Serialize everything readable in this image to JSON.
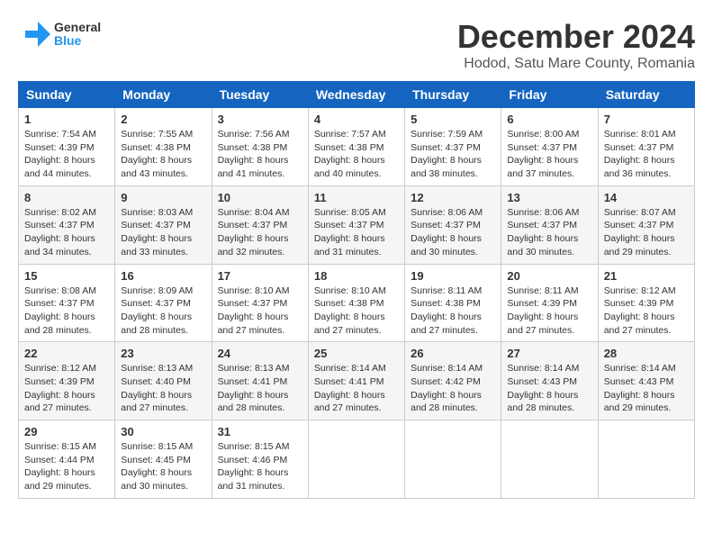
{
  "logo": {
    "line1": "General",
    "line2": "Blue"
  },
  "title": "December 2024",
  "location": "Hodod, Satu Mare County, Romania",
  "headers": [
    "Sunday",
    "Monday",
    "Tuesday",
    "Wednesday",
    "Thursday",
    "Friday",
    "Saturday"
  ],
  "weeks": [
    [
      {
        "day": "1",
        "info": "Sunrise: 7:54 AM\nSunset: 4:39 PM\nDaylight: 8 hours\nand 44 minutes."
      },
      {
        "day": "2",
        "info": "Sunrise: 7:55 AM\nSunset: 4:38 PM\nDaylight: 8 hours\nand 43 minutes."
      },
      {
        "day": "3",
        "info": "Sunrise: 7:56 AM\nSunset: 4:38 PM\nDaylight: 8 hours\nand 41 minutes."
      },
      {
        "day": "4",
        "info": "Sunrise: 7:57 AM\nSunset: 4:38 PM\nDaylight: 8 hours\nand 40 minutes."
      },
      {
        "day": "5",
        "info": "Sunrise: 7:59 AM\nSunset: 4:37 PM\nDaylight: 8 hours\nand 38 minutes."
      },
      {
        "day": "6",
        "info": "Sunrise: 8:00 AM\nSunset: 4:37 PM\nDaylight: 8 hours\nand 37 minutes."
      },
      {
        "day": "7",
        "info": "Sunrise: 8:01 AM\nSunset: 4:37 PM\nDaylight: 8 hours\nand 36 minutes."
      }
    ],
    [
      {
        "day": "8",
        "info": "Sunrise: 8:02 AM\nSunset: 4:37 PM\nDaylight: 8 hours\nand 34 minutes."
      },
      {
        "day": "9",
        "info": "Sunrise: 8:03 AM\nSunset: 4:37 PM\nDaylight: 8 hours\nand 33 minutes."
      },
      {
        "day": "10",
        "info": "Sunrise: 8:04 AM\nSunset: 4:37 PM\nDaylight: 8 hours\nand 32 minutes."
      },
      {
        "day": "11",
        "info": "Sunrise: 8:05 AM\nSunset: 4:37 PM\nDaylight: 8 hours\nand 31 minutes."
      },
      {
        "day": "12",
        "info": "Sunrise: 8:06 AM\nSunset: 4:37 PM\nDaylight: 8 hours\nand 30 minutes."
      },
      {
        "day": "13",
        "info": "Sunrise: 8:06 AM\nSunset: 4:37 PM\nDaylight: 8 hours\nand 30 minutes."
      },
      {
        "day": "14",
        "info": "Sunrise: 8:07 AM\nSunset: 4:37 PM\nDaylight: 8 hours\nand 29 minutes."
      }
    ],
    [
      {
        "day": "15",
        "info": "Sunrise: 8:08 AM\nSunset: 4:37 PM\nDaylight: 8 hours\nand 28 minutes."
      },
      {
        "day": "16",
        "info": "Sunrise: 8:09 AM\nSunset: 4:37 PM\nDaylight: 8 hours\nand 28 minutes."
      },
      {
        "day": "17",
        "info": "Sunrise: 8:10 AM\nSunset: 4:37 PM\nDaylight: 8 hours\nand 27 minutes."
      },
      {
        "day": "18",
        "info": "Sunrise: 8:10 AM\nSunset: 4:38 PM\nDaylight: 8 hours\nand 27 minutes."
      },
      {
        "day": "19",
        "info": "Sunrise: 8:11 AM\nSunset: 4:38 PM\nDaylight: 8 hours\nand 27 minutes."
      },
      {
        "day": "20",
        "info": "Sunrise: 8:11 AM\nSunset: 4:39 PM\nDaylight: 8 hours\nand 27 minutes."
      },
      {
        "day": "21",
        "info": "Sunrise: 8:12 AM\nSunset: 4:39 PM\nDaylight: 8 hours\nand 27 minutes."
      }
    ],
    [
      {
        "day": "22",
        "info": "Sunrise: 8:12 AM\nSunset: 4:39 PM\nDaylight: 8 hours\nand 27 minutes."
      },
      {
        "day": "23",
        "info": "Sunrise: 8:13 AM\nSunset: 4:40 PM\nDaylight: 8 hours\nand 27 minutes."
      },
      {
        "day": "24",
        "info": "Sunrise: 8:13 AM\nSunset: 4:41 PM\nDaylight: 8 hours\nand 28 minutes."
      },
      {
        "day": "25",
        "info": "Sunrise: 8:14 AM\nSunset: 4:41 PM\nDaylight: 8 hours\nand 27 minutes."
      },
      {
        "day": "26",
        "info": "Sunrise: 8:14 AM\nSunset: 4:42 PM\nDaylight: 8 hours\nand 28 minutes."
      },
      {
        "day": "27",
        "info": "Sunrise: 8:14 AM\nSunset: 4:43 PM\nDaylight: 8 hours\nand 28 minutes."
      },
      {
        "day": "28",
        "info": "Sunrise: 8:14 AM\nSunset: 4:43 PM\nDaylight: 8 hours\nand 29 minutes."
      }
    ],
    [
      {
        "day": "29",
        "info": "Sunrise: 8:15 AM\nSunset: 4:44 PM\nDaylight: 8 hours\nand 29 minutes."
      },
      {
        "day": "30",
        "info": "Sunrise: 8:15 AM\nSunset: 4:45 PM\nDaylight: 8 hours\nand 30 minutes."
      },
      {
        "day": "31",
        "info": "Sunrise: 8:15 AM\nSunset: 4:46 PM\nDaylight: 8 hours\nand 31 minutes."
      },
      null,
      null,
      null,
      null
    ]
  ]
}
